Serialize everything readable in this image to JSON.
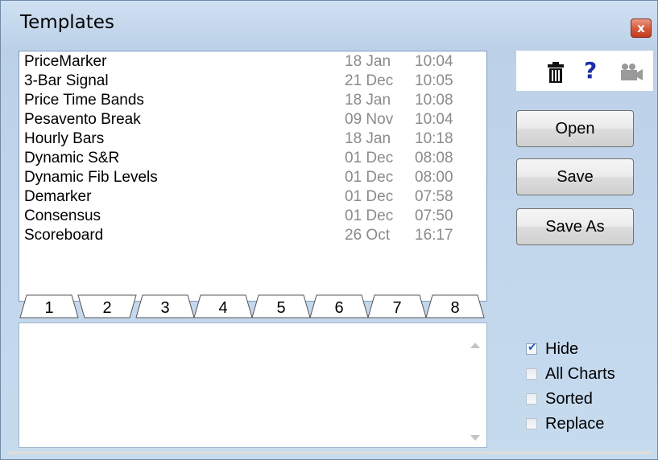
{
  "window": {
    "title": "Templates",
    "close_glyph": "x"
  },
  "templates": [
    {
      "name": "PriceMarker",
      "date": "18 Jan",
      "time": "10:04"
    },
    {
      "name": "3-Bar Signal",
      "date": "21 Dec",
      "time": "10:05"
    },
    {
      "name": "Price Time Bands",
      "date": "18 Jan",
      "time": "10:08"
    },
    {
      "name": "Pesavento Break",
      "date": "09 Nov",
      "time": "10:04"
    },
    {
      "name": "Hourly Bars",
      "date": "18 Jan",
      "time": "10:18"
    },
    {
      "name": "Dynamic S&R",
      "date": "01 Dec",
      "time": "08:08"
    },
    {
      "name": "Dynamic Fib Levels",
      "date": "01 Dec",
      "time": "08:00"
    },
    {
      "name": "Demarker",
      "date": "01 Dec",
      "time": "07:58"
    },
    {
      "name": "Consensus",
      "date": "01 Dec",
      "time": "07:50"
    },
    {
      "name": "Scoreboard",
      "date": "26 Oct",
      "time": "16:17"
    }
  ],
  "tabs": {
    "labels": [
      "1",
      "2",
      "3",
      "4",
      "5",
      "6",
      "7",
      "8"
    ],
    "active": "2"
  },
  "toolbar": {
    "icons": [
      "trash-icon",
      "help-icon",
      "camera-icon"
    ],
    "help_glyph": "?"
  },
  "buttons": {
    "open": "Open",
    "save": "Save",
    "save_as": "Save As"
  },
  "options": [
    {
      "label": "Hide",
      "checked": true
    },
    {
      "label": "All Charts",
      "checked": false
    },
    {
      "label": "Sorted",
      "checked": false
    },
    {
      "label": "Replace",
      "checked": false
    }
  ],
  "notes": {
    "value": ""
  },
  "colors": {
    "title_accent": "#1d2fa8",
    "close_button": "#c23c1f",
    "date_text": "#8a8a8a",
    "checkmark": "#2b5db8"
  }
}
